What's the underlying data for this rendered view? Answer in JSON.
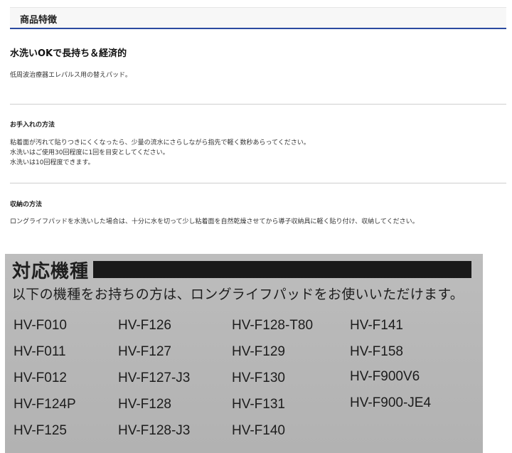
{
  "header": {
    "title": "商品特徴"
  },
  "feature": {
    "title": "水洗いOKで長持ち＆経済的",
    "description": "低周波治療器エレパルス用の替えパッド。"
  },
  "care": {
    "title": "お手入れの方法",
    "lines": [
      "粘着面が汚れて貼りつきにくくなったら、少量の流水にさらしながら指先で軽く数秒あらってください。",
      "水洗いはご使用30回程度に1回を目安としてください。",
      "水洗いは10回程度できます。"
    ]
  },
  "storage": {
    "title": "収納の方法",
    "lines": [
      "ロングライフパッドを水洗いした場合は、十分に水を切って少し粘着面を自然乾燥させてから導子収納具に軽く貼り付け、収納してください。"
    ]
  },
  "compatible": {
    "title": "対応機種",
    "subtitle": "以下の機種をお持ちの方は、ロングライフパッドをお使いいただけます。",
    "columns": [
      [
        "HV-F010",
        "HV-F011",
        "HV-F012",
        "HV-F124P",
        "HV-F125"
      ],
      [
        "HV-F126",
        "HV-F127",
        "HV-F127-J3",
        "HV-F128",
        "HV-F128-J3"
      ],
      [
        "HV-F128-T80",
        "HV-F129",
        "HV-F130",
        "HV-F131",
        "HV-F140"
      ],
      [
        "HV-F141",
        "HV-F158",
        "HV-F900V6",
        "HV-F900-JE4"
      ]
    ]
  }
}
